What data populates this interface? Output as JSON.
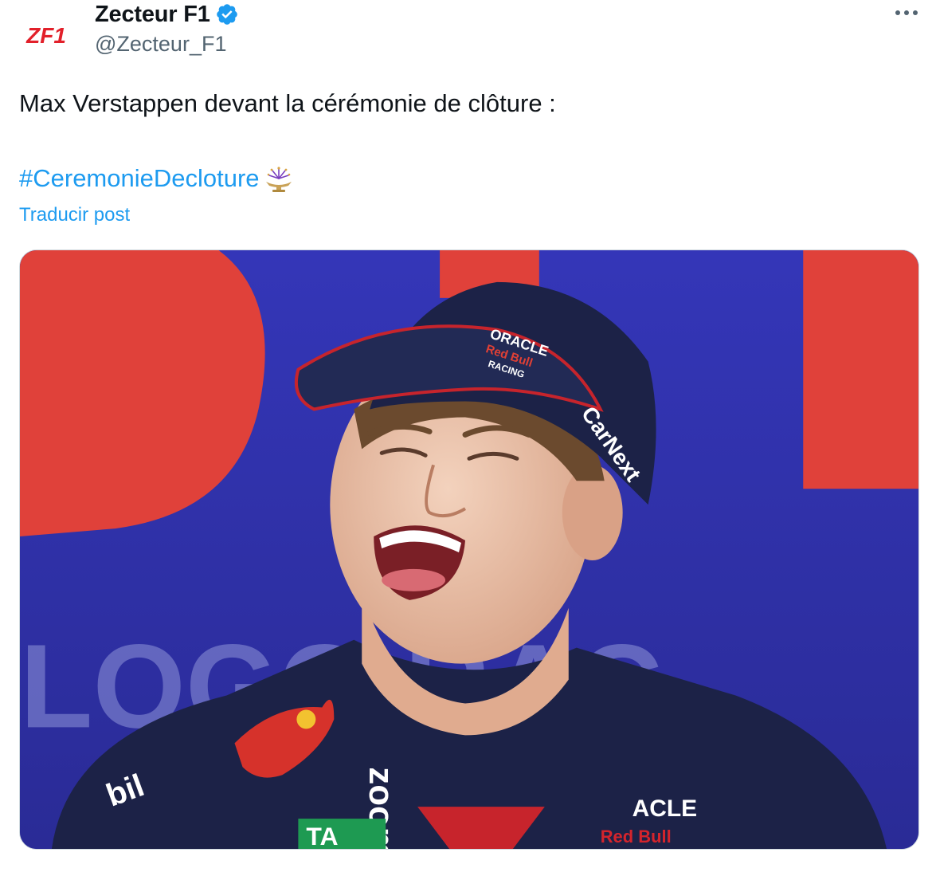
{
  "author": {
    "name": "Zecteur F1",
    "handle": "@Zecteur_F1",
    "avatar_text": "ZF1",
    "verified": true
  },
  "tweet": {
    "text": "Max Verstappen devant la cérémonie de clôture :",
    "hashtag": "#CeremonieDecloture",
    "emoji": "fountain-fireworks-icon",
    "translate_label": "Traducir post"
  },
  "media": {
    "cap_text_line1": "ORACLE",
    "cap_text_line2": "Red Bull",
    "cap_text_line3": "RACING",
    "cap_side_text": "CarNext",
    "shirt_text": "zoom",
    "shirt_logo_text": "ACLE",
    "shirt_brand_text": "Red Bull",
    "shirt_left_text": "bil",
    "shirt_tag_text": "TA",
    "background_text": "LOGO RAC"
  },
  "colors": {
    "link": "#1d9bf0",
    "secondary_text": "#536471",
    "avatar_red": "#e2202a",
    "backdrop_blue": "#2d2fa8",
    "backdrop_red": "#e0413a"
  }
}
